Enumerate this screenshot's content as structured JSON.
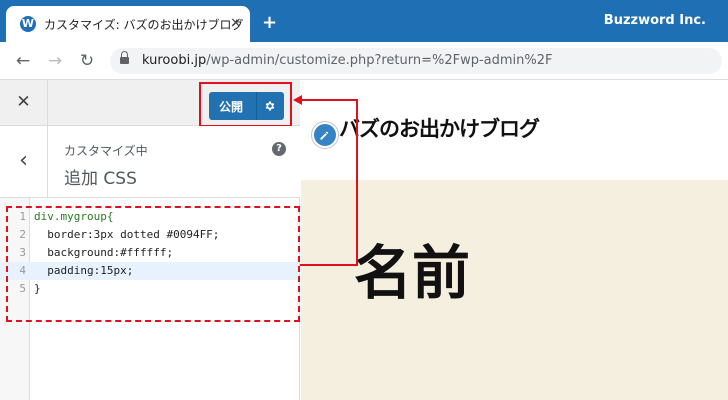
{
  "browser": {
    "tab_title": "カスタマイズ: バズのお出かけブログ",
    "tab_close_glyph": "×",
    "new_tab_glyph": "+",
    "brand": "Buzzword Inc.",
    "back_glyph": "←",
    "forward_glyph": "→",
    "reload_glyph": "↻",
    "url_host": "kuroobi.jp",
    "url_path": "/wp-admin/customize.php?return=%2Fwp-admin%2F"
  },
  "customizer": {
    "close_glyph": "✕",
    "publish_label": "公開",
    "back_glyph": "‹",
    "section_small": "カスタマイズ中",
    "section_title": "追加 CSS",
    "help_glyph": "?",
    "css_lines": [
      {
        "num": "1",
        "text": "div.mygroup{"
      },
      {
        "num": "2",
        "text": "  border:3px dotted #0094FF;"
      },
      {
        "num": "3",
        "text": "  background:#ffffff;"
      },
      {
        "num": "4",
        "text": "  padding:15px;"
      },
      {
        "num": "5",
        "text": "}"
      }
    ]
  },
  "preview": {
    "site_title": "バズのお出かけブログ",
    "big_text": "名前"
  },
  "colors": {
    "tab_bar": "#1f6fb5",
    "publish_button": "#2271b1",
    "annotation_red": "#e0101c",
    "preview_body": "#f5efe0"
  },
  "icons": {
    "favicon": "wordpress-icon",
    "lock": "lock-icon",
    "publish_settings": "gear-icon",
    "edit_shortcut": "pencil-icon",
    "help": "help-icon"
  }
}
